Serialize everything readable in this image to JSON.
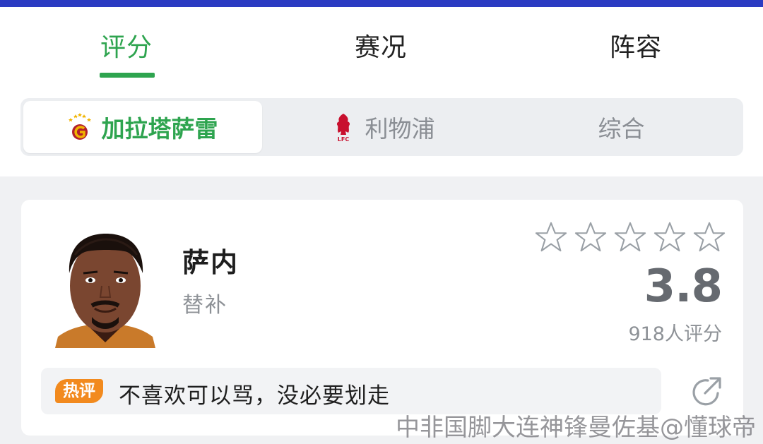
{
  "tabs": [
    {
      "label": "评分",
      "active": true
    },
    {
      "label": "赛况",
      "active": false
    },
    {
      "label": "阵容",
      "active": false
    }
  ],
  "teams": [
    {
      "label": "加拉塔萨雷",
      "icon": "galatasaray-crest-icon",
      "active": true
    },
    {
      "label": "利物浦",
      "icon": "liverpool-crest-icon",
      "active": false
    },
    {
      "label": "综合",
      "active": false
    }
  ],
  "player": {
    "name": "萨内",
    "role": "替补",
    "stars_filled": 0,
    "stars_total": 5,
    "score": "3.8",
    "rating_count": "918人评分"
  },
  "comment": {
    "badge": "热评",
    "text": "不喜欢可以骂，没必要划走",
    "share_icon": "share-icon"
  },
  "watermark": "中非国脚大连神锋曼佐基@懂球帝",
  "colors": {
    "accent": "#2ea44f",
    "hot": "#f28a1e",
    "topbar": "#2b3bc2"
  }
}
